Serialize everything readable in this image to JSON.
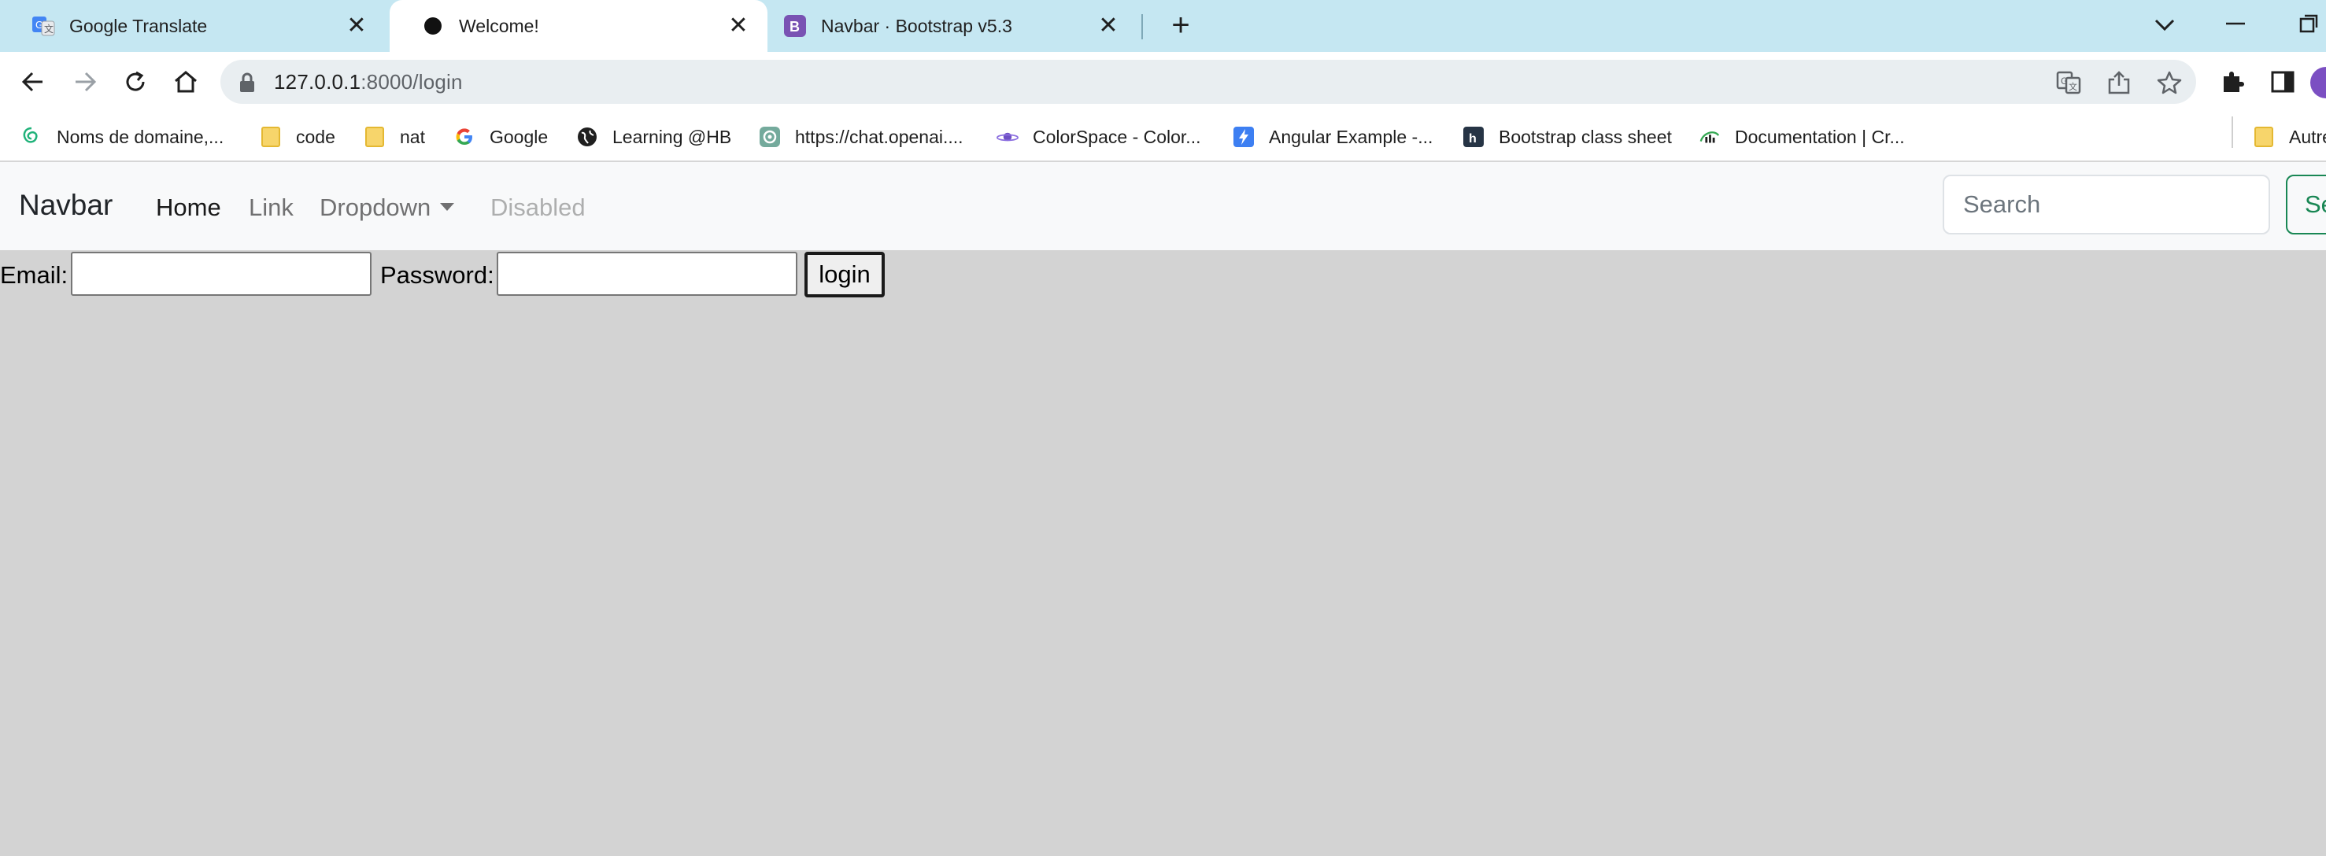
{
  "browser": {
    "tabs": [
      {
        "title": "Google Translate",
        "favicon": "google-translate-icon"
      },
      {
        "title": "Welcome!",
        "favicon": "circle-icon",
        "active": true
      },
      {
        "title": "Navbar · Bootstrap v5.3",
        "favicon": "bootstrap-icon"
      }
    ],
    "close_glyph": "✕",
    "new_tab_glyph": "+",
    "url_host": "127.0.0.1",
    "url_path": ":8000/login",
    "bookmarks": [
      {
        "label": "Noms de domaine,...",
        "icon": "swirl-icon"
      },
      {
        "label": "code",
        "icon": "folder-icon"
      },
      {
        "label": "nat",
        "icon": "folder-icon"
      },
      {
        "label": "Google",
        "icon": "google-icon"
      },
      {
        "label": "Learning @HB",
        "icon": "globe-icon"
      },
      {
        "label": "https://chat.openai....",
        "icon": "openai-icon"
      },
      {
        "label": "ColorSpace - Color...",
        "icon": "planet-icon"
      },
      {
        "label": "Angular Example -...",
        "icon": "bolt-icon"
      },
      {
        "label": "Bootstrap class sheet",
        "icon": "h-icon"
      },
      {
        "label": "Documentation | Cr...",
        "icon": "chart-icon"
      },
      {
        "label": "Autre",
        "icon": "folder-icon"
      }
    ]
  },
  "navbar": {
    "brand": "Navbar",
    "links": {
      "home": "Home",
      "link": "Link",
      "dropdown": "Dropdown",
      "disabled": "Disabled"
    },
    "search_placeholder": "Search",
    "search_button": "Search"
  },
  "login": {
    "email_label": "Email:",
    "password_label": "Password:",
    "submit_label": "login"
  },
  "colors": {
    "tabstrip": "#c5e7f2",
    "page_background": "#d3d3d3",
    "navbar_background": "#f8f9fa",
    "success": "#198754"
  }
}
